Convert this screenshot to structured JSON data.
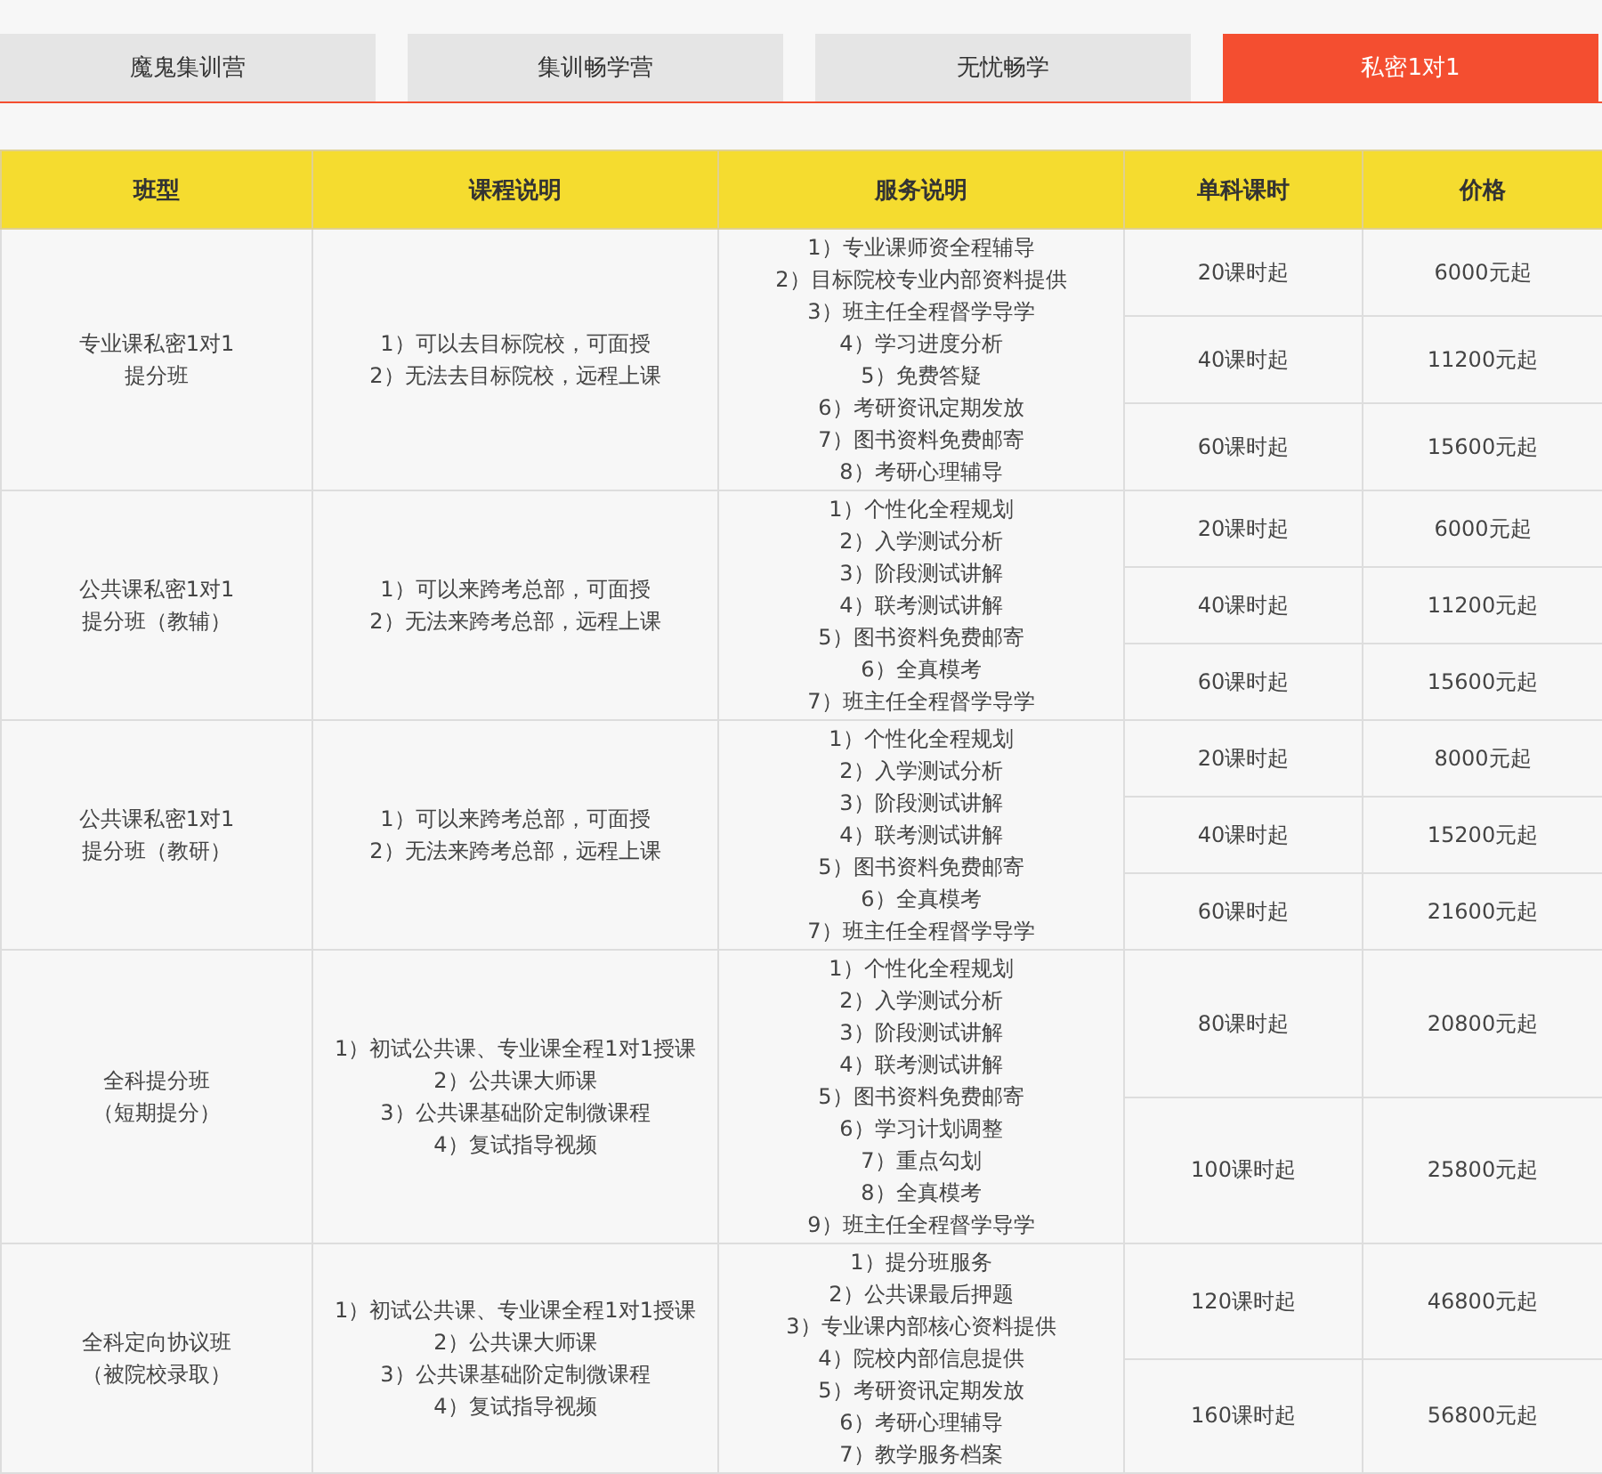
{
  "tabs": [
    {
      "label": "魔鬼集训营",
      "selected": false
    },
    {
      "label": "集训畅学营",
      "selected": false
    },
    {
      "label": "无忧畅学",
      "selected": false
    },
    {
      "label": "私密1对1",
      "selected": true
    }
  ],
  "table": {
    "columns": [
      "班型",
      "课程说明",
      "服务说明",
      "单科课时",
      "价格"
    ],
    "rows": [
      {
        "class": [
          "专业课私密1对1",
          "提分班"
        ],
        "course": [
          "1）可以去目标院校，可面授",
          "2）无法去目标院校，远程上课"
        ],
        "services": [
          "1）专业课师资全程辅导",
          "2）目标院校专业内部资料提供",
          "3）班主任全程督学导学",
          "4）学习进度分析",
          "5）免费答疑",
          "6）考研资讯定期发放",
          "7）图书资料免费邮寄",
          "8）考研心理辅导"
        ],
        "options": [
          {
            "hours": "20课时起",
            "price": "6000元起"
          },
          {
            "hours": "40课时起",
            "price": "11200元起"
          },
          {
            "hours": "60课时起",
            "price": "15600元起"
          }
        ]
      },
      {
        "class": [
          "公共课私密1对1",
          "提分班（教辅）"
        ],
        "course": [
          "1）可以来跨考总部，可面授",
          "2）无法来跨考总部，远程上课"
        ],
        "services": [
          "1）个性化全程规划",
          "2）入学测试分析",
          "3）阶段测试讲解",
          "4）联考测试讲解",
          "5）图书资料免费邮寄",
          "6）全真模考",
          "7）班主任全程督学导学"
        ],
        "options": [
          {
            "hours": "20课时起",
            "price": "6000元起"
          },
          {
            "hours": "40课时起",
            "price": "11200元起"
          },
          {
            "hours": "60课时起",
            "price": "15600元起"
          }
        ]
      },
      {
        "class": [
          "公共课私密1对1",
          "提分班（教研）"
        ],
        "course": [
          "1）可以来跨考总部，可面授",
          "2）无法来跨考总部，远程上课"
        ],
        "services": [
          "1）个性化全程规划",
          "2）入学测试分析",
          "3）阶段测试讲解",
          "4）联考测试讲解",
          "5）图书资料免费邮寄",
          "6）全真模考",
          "7）班主任全程督学导学"
        ],
        "options": [
          {
            "hours": "20课时起",
            "price": "8000元起"
          },
          {
            "hours": "40课时起",
            "price": "15200元起"
          },
          {
            "hours": "60课时起",
            "price": "21600元起"
          }
        ]
      },
      {
        "class": [
          "全科提分班",
          "（短期提分）"
        ],
        "course": [
          "1）初试公共课、专业课全程1对1授课",
          "2）公共课大师课",
          "3）公共课基础阶定制微课程",
          "4）复试指导视频"
        ],
        "services": [
          "1）个性化全程规划",
          "2）入学测试分析",
          "3）阶段测试讲解",
          "4）联考测试讲解",
          "5）图书资料免费邮寄",
          "6）学习计划调整",
          "7）重点勾划",
          "8）全真模考",
          "9）班主任全程督学导学"
        ],
        "options": [
          {
            "hours": "80课时起",
            "price": "20800元起"
          },
          {
            "hours": "100课时起",
            "price": "25800元起"
          }
        ]
      },
      {
        "class": [
          "全科定向协议班",
          "（被院校录取）"
        ],
        "course": [
          "1）初试公共课、专业课全程1对1授课",
          "2）公共课大师课",
          "3）公共课基础阶定制微课程",
          "4）复试指导视频"
        ],
        "services": [
          "1）提分班服务",
          "2）公共课最后押题",
          "3）专业课内部核心资料提供",
          "4）院校内部信息提供",
          "5）考研资讯定期发放",
          "6）考研心理辅导",
          "7）教学服务档案"
        ],
        "options": [
          {
            "hours": "120课时起",
            "price": "46800元起"
          },
          {
            "hours": "160课时起",
            "price": "56800元起"
          }
        ]
      }
    ]
  }
}
